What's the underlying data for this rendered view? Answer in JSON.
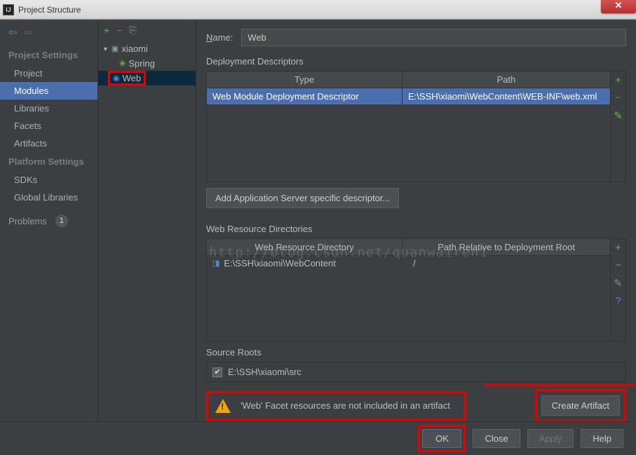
{
  "title": "Project Structure",
  "closeGlyph": "✕",
  "nav": {
    "projectSettingsHead": "Project Settings",
    "project": "Project",
    "modules": "Modules",
    "libraries": "Libraries",
    "facets": "Facets",
    "artifacts": "Artifacts",
    "platformSettingsHead": "Platform Settings",
    "sdks": "SDKs",
    "globalLibraries": "Global Libraries",
    "problems": "Problems",
    "problemsCount": "1"
  },
  "tree": {
    "root": "xiaomi",
    "spring": "Spring",
    "web": "Web"
  },
  "name": {
    "label": "Name:",
    "labelKey": "N",
    "value": "Web"
  },
  "deployment": {
    "label": "Deployment Descriptors",
    "col1": "Type",
    "col2": "Path",
    "rowType": "Web Module Deployment Descriptor",
    "rowPath": "E:\\SSH\\xiaomi\\WebContent\\WEB-INF\\web.xml"
  },
  "appServerBtn": "Add Application Server specific descriptor...",
  "resources": {
    "label": "Web Resource Directories",
    "col1": "Web Resource Directory",
    "col2": "Path Relative to Deployment Root",
    "dir": "E:\\SSH\\xiaomi\\WebContent",
    "rel": "/"
  },
  "sourceRoots": {
    "label": "Source Roots",
    "path": "E:\\SSH\\xiaomi\\src"
  },
  "warn": {
    "text": "'Web' Facet resources are not included in an artifact",
    "btn": "Create Artifact"
  },
  "watermark": "http://blog.csdn.net/quanwairen1",
  "buttons": {
    "ok": "OK",
    "cancel": "Close",
    "apply": "Apply",
    "help": "Help"
  }
}
